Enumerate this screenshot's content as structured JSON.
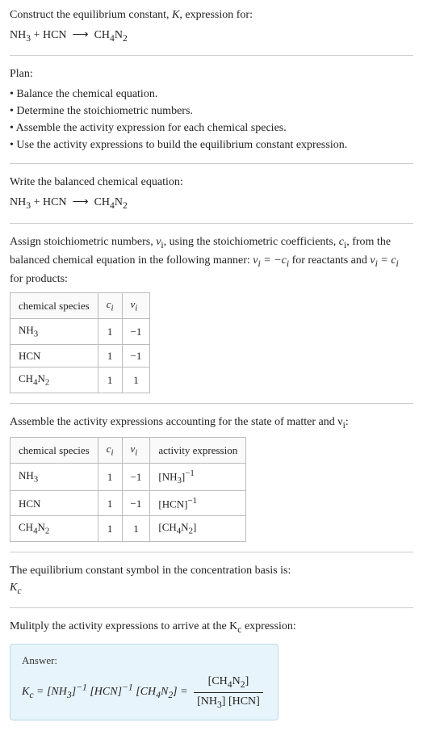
{
  "header": {
    "prompt_text": "Construct the equilibrium constant, ",
    "prompt_var": "K",
    "prompt_tail": ", expression for:",
    "equation_html": "NH<sub>3</sub> + HCN &nbsp;⟶&nbsp; CH<sub>4</sub>N<sub>2</sub>"
  },
  "plan": {
    "title": "Plan:",
    "items": [
      "Balance the chemical equation.",
      "Determine the stoichiometric numbers.",
      "Assemble the activity expression for each chemical species.",
      "Use the activity expressions to build the equilibrium constant expression."
    ]
  },
  "balanced": {
    "intro": "Write the balanced chemical equation:",
    "equation_html": "NH<sub>3</sub> + HCN &nbsp;⟶&nbsp; CH<sub>4</sub>N<sub>2</sub>"
  },
  "stoich": {
    "intro_1": "Assign stoichiometric numbers, ",
    "nu": "ν",
    "sub_i": "i",
    "intro_2": ", using the stoichiometric coefficients, ",
    "c": "c",
    "intro_3": ", from the balanced chemical equation in the following manner: ",
    "eq1": "ν<sub>i</sub> = −c<sub>i</sub>",
    "intro_4": " for reactants and ",
    "eq2": "ν<sub>i</sub> = c<sub>i</sub>",
    "intro_5": " for products:",
    "table": {
      "headers": [
        "chemical species",
        "c<sub>i</sub>",
        "ν<sub>i</sub>"
      ],
      "rows": [
        {
          "species": "NH<sub>3</sub>",
          "c": "1",
          "nu": "−1"
        },
        {
          "species": "HCN",
          "c": "1",
          "nu": "−1"
        },
        {
          "species": "CH<sub>4</sub>N<sub>2</sub>",
          "c": "1",
          "nu": "1"
        }
      ]
    }
  },
  "activity": {
    "intro": "Assemble the activity expressions accounting for the state of matter and ν<sub>i</sub>:",
    "table": {
      "headers": [
        "chemical species",
        "c<sub>i</sub>",
        "ν<sub>i</sub>",
        "activity expression"
      ],
      "rows": [
        {
          "species": "NH<sub>3</sub>",
          "c": "1",
          "nu": "−1",
          "act": "[NH<sub>3</sub>]<sup>−1</sup>"
        },
        {
          "species": "HCN",
          "c": "1",
          "nu": "−1",
          "act": "[HCN]<sup>−1</sup>"
        },
        {
          "species": "CH<sub>4</sub>N<sub>2</sub>",
          "c": "1",
          "nu": "1",
          "act": "[CH<sub>4</sub>N<sub>2</sub>]"
        }
      ]
    }
  },
  "kc_symbol": {
    "intro": "The equilibrium constant symbol in the concentration basis is:",
    "symbol": "K<sub>c</sub>"
  },
  "multiply": {
    "intro": "Mulitply the activity expressions to arrive at the K<sub>c</sub> expression:"
  },
  "answer": {
    "label": "Answer:",
    "lhs": "K<sub>c</sub> = [NH<sub>3</sub>]<sup>−1</sup> [HCN]<sup>−1</sup> [CH<sub>4</sub>N<sub>2</sub>] = ",
    "num": "[CH<sub>4</sub>N<sub>2</sub>]",
    "den": "[NH<sub>3</sub>] [HCN]"
  }
}
